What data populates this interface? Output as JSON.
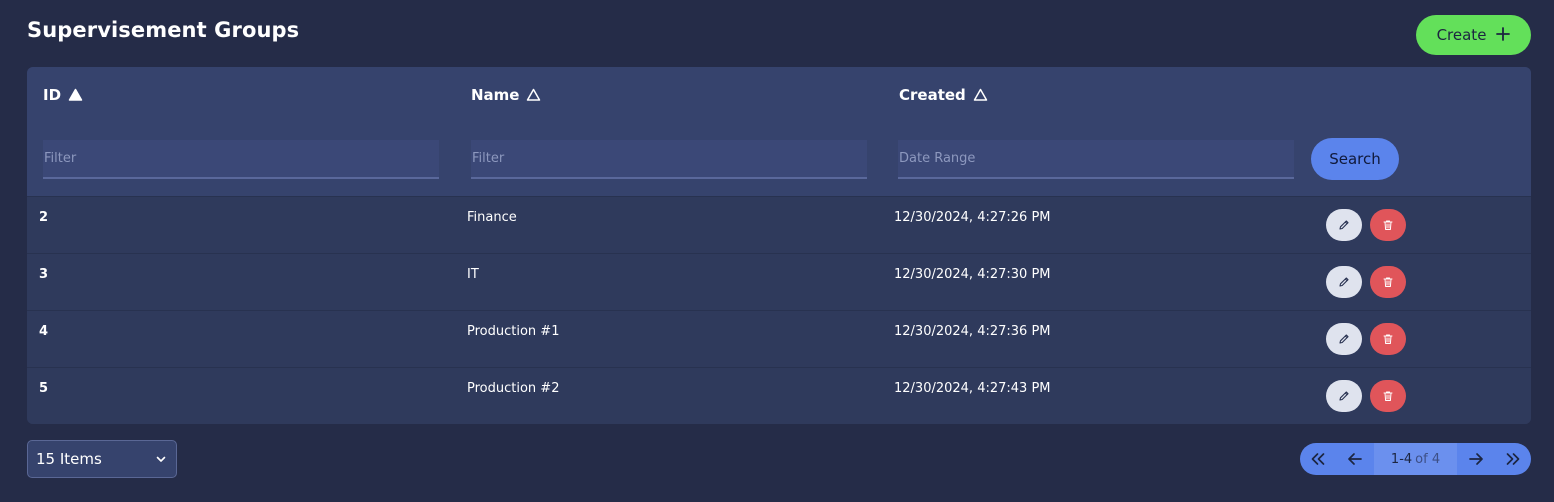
{
  "page": {
    "title": "Supervisement Groups",
    "create_label": "Create"
  },
  "table": {
    "columns": [
      {
        "label": "ID",
        "sort": "ascending"
      },
      {
        "label": "Name",
        "sort": "none"
      },
      {
        "label": "Created",
        "sort": "none"
      }
    ],
    "filters": [
      {
        "placeholder": "Filter"
      },
      {
        "placeholder": "Filter"
      },
      {
        "placeholder": "Date Range"
      }
    ],
    "search_label": "Search",
    "rows": [
      {
        "id": "2",
        "name": "Finance",
        "created": "12/30/2024, 4:27:26 PM"
      },
      {
        "id": "3",
        "name": "IT",
        "created": "12/30/2024, 4:27:30 PM"
      },
      {
        "id": "4",
        "name": "Production #1",
        "created": "12/30/2024, 4:27:36 PM"
      },
      {
        "id": "5",
        "name": "Production #2",
        "created": "12/30/2024, 4:27:43 PM"
      }
    ],
    "row_actions": {
      "edit_icon": "pencil-icon",
      "delete_icon": "trash-icon"
    }
  },
  "pagination": {
    "items_per_page": "15 Items",
    "range": "1-4",
    "of_total": "of 4",
    "icons": [
      "double-chevron-left-icon",
      "arrow-left-icon",
      "arrow-right-icon",
      "double-chevron-right-icon"
    ]
  },
  "colors": {
    "background": "#252c48",
    "card": "#2f3a5c",
    "header": "#36436d",
    "create": "#63e05a",
    "primary": "#5b84ec",
    "danger": "#e0555a"
  }
}
